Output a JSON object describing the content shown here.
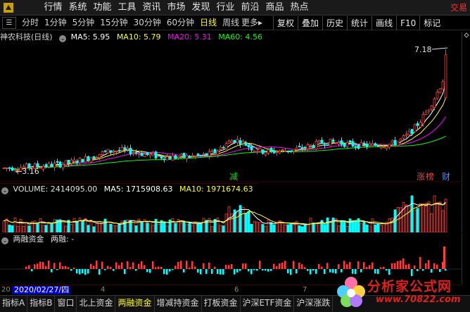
{
  "menu": {
    "items": [
      "行情",
      "系统",
      "功能",
      "工具",
      "资讯",
      "市场",
      "发现",
      "行业",
      "前沿",
      "商品",
      "热点"
    ],
    "trade": "交易"
  },
  "toolbar": {
    "periods": [
      "分时",
      "1分钟",
      "5分钟",
      "15分钟",
      "30分钟",
      "60分钟",
      "日线",
      "周线"
    ],
    "active": "日线",
    "more": "更多",
    "more_arrow": "▸",
    "actions": [
      "复权",
      "叠加",
      "历史",
      "统计",
      "画线",
      "F10",
      "标记"
    ]
  },
  "header": {
    "stock": "神农科技",
    "period": "(日线)",
    "ma5": "MA5: 5.95",
    "ma10": "MA10: 5.79",
    "ma20": "MA20: 5.31",
    "ma60": "MA60: 4.56"
  },
  "price": {
    "high_label": "7.18",
    "low_label": "3.16",
    "low_arrow": "←",
    "badge_jian": "减",
    "badge_zhang": "涨",
    "badge_bang": "榜",
    "badge_cai": "财"
  },
  "volume": {
    "label": "VOLUME: 2414095.00",
    "ma5": "MA5: 1715908.63",
    "ma10": "MA10: 1971674.63"
  },
  "margin": {
    "label": "两融资金",
    "value": "两融: -"
  },
  "xaxis": {
    "date": "2020/02/27/四",
    "year": "20",
    "ticks": [
      "4",
      "6",
      "7"
    ]
  },
  "tabs": [
    "指标A",
    "指标B",
    "窗口",
    "北上资金",
    "两融资金",
    "增减持资金",
    "打板资金",
    "沪深ETF资金",
    "沪深涨跌"
  ],
  "active_tab": "两融资金",
  "watermark": {
    "text": "分析家公式网",
    "url": "www.70822.com"
  },
  "colors": {
    "up": "#ff3c3c",
    "down": "#00ffff",
    "ma5": "#ffffff",
    "ma10": "#ffff00",
    "ma20": "#ff00ff",
    "ma60": "#00ff00"
  },
  "chart_data": {
    "type": "candlestick",
    "title": "神农科技 (日线)",
    "price_marks": {
      "high": 7.18,
      "low": 3.16
    },
    "moving_averages": {
      "MA5": 5.95,
      "MA10": 5.79,
      "MA20": 5.31,
      "MA60": 4.56
    },
    "volume": {
      "last": 2414095.0,
      "MA5": 1715908.63,
      "MA10": 1971674.63
    },
    "start_date": "2020/02/27"
  }
}
